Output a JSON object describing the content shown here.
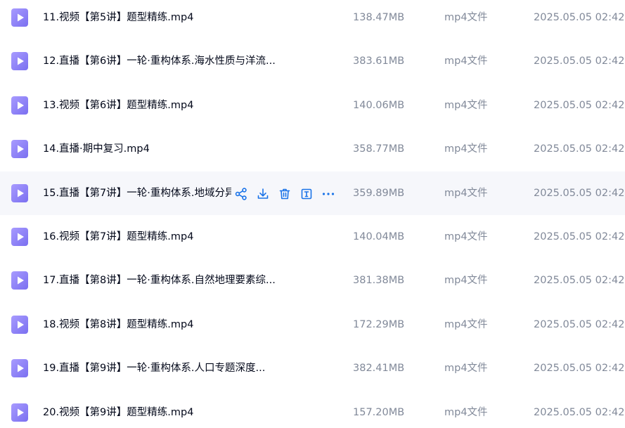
{
  "files": [
    {
      "name": "11.视频【第5讲】题型精练.mp4",
      "size": "138.47MB",
      "type": "mp4文件",
      "date": "2025.05.05 02:42"
    },
    {
      "name": "12.直播【第6讲】一轮·重构体系.海水性质与洋流...",
      "size": "383.61MB",
      "type": "mp4文件",
      "date": "2025.05.05 02:42"
    },
    {
      "name": "13.视频【第6讲】题型精练.mp4",
      "size": "140.06MB",
      "type": "mp4文件",
      "date": "2025.05.05 02:42"
    },
    {
      "name": "14.直播·期中复习.mp4",
      "size": "358.77MB",
      "type": "mp4文件",
      "date": "2025.05.05 02:42"
    },
    {
      "name": "15.直播【第7讲】一轮·重构体系.地域分异",
      "size": "359.89MB",
      "type": "mp4文件",
      "date": "2025.05.05 02:42",
      "hovered": true
    },
    {
      "name": "16.视频【第7讲】题型精练.mp4",
      "size": "140.04MB",
      "type": "mp4文件",
      "date": "2025.05.05 02:42"
    },
    {
      "name": "17.直播【第8讲】一轮·重构体系.自然地理要素综...",
      "size": "381.38MB",
      "type": "mp4文件",
      "date": "2025.05.05 02:42"
    },
    {
      "name": "18.视频【第8讲】题型精练.mp4",
      "size": "172.29MB",
      "type": "mp4文件",
      "date": "2025.05.05 02:42"
    },
    {
      "name": "19.直播【第9讲】一轮·重构体系.人口专题深度...",
      "size": "382.41MB",
      "type": "mp4文件",
      "date": "2025.05.05 02:42"
    },
    {
      "name": "20.视频【第9讲】题型精练.mp4",
      "size": "157.20MB",
      "type": "mp4文件",
      "date": "2025.05.05 02:42"
    }
  ],
  "icons": {
    "file": "video-file-icon",
    "actions": [
      "share-icon",
      "download-icon",
      "delete-icon",
      "rename-icon",
      "more-icon"
    ]
  },
  "colors": {
    "accent": "#1a73e8",
    "icon_purple": "#8e84f7",
    "hover_bg": "#f6f7fb",
    "meta_text": "#818999"
  }
}
